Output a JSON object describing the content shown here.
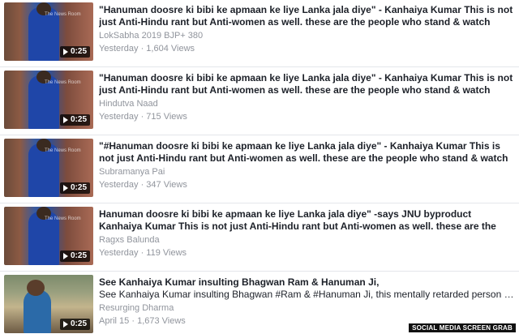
{
  "videos": [
    {
      "title": "\"Hanuman doosre ki bibi ke apmaan ke liye Lanka jala diye\" - Kanhaiya Kumar This is not just Anti-Hindu rant but Anti-women as well. these are the people who stand & watch when women...",
      "source": "LokSabha 2019 BJP+ 380",
      "meta": "Yesterday · 1,604 Views",
      "duration": "0:25"
    },
    {
      "title": "\"Hanuman doosre ki bibi ke apmaan ke liye Lanka jala diye\" - Kanhaiya Kumar This is not just Anti-Hindu rant but Anti-women as well. these are the people who stand & watch when women...",
      "source": "Hindutva Naad",
      "meta": "Yesterday · 715 Views",
      "duration": "0:25"
    },
    {
      "title": "\"#Hanuman doosre ki bibi ke apmaan ke liye Lanka jala diye\" - Kanhaiya Kumar This is not just Anti-Hindu rant but Anti-women as well. these are the people who stand & watch when women...",
      "source": "Subramanya Pai",
      "meta": "Yesterday · 347 Views",
      "duration": "0:25"
    },
    {
      "title": "Hanuman doosre ki bibi ke apmaan ke liye Lanka jala diye\" -says JNU byproduct Kanhaiya Kumar This is not just Anti-Hindu rant but Anti-women as well. these are the people who stand...",
      "source": "Ragxs Balunda",
      "meta": "Yesterday · 119 Views",
      "duration": "0:25"
    },
    {
      "title": "See Kanhaiya Kumar insulting Bhagwan Ram & Hanuman Ji,",
      "description": "See Kanhaiya Kumar insulting Bhagwan #Ram & #Hanuman Ji, this mentally retarded person wants t...",
      "source": "Resurging Dharma",
      "meta": "April 15 · 1,673 Views",
      "duration": "0:25"
    }
  ],
  "thumbnail_watermark": "The News Room",
  "credit": "SOCIAL MEDIA SCREEN GRAB"
}
